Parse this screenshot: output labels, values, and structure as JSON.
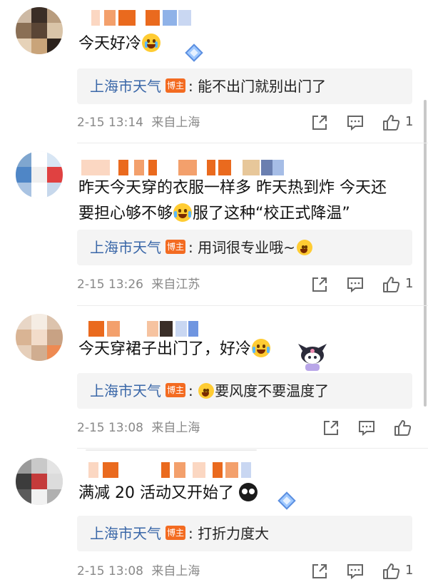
{
  "comments": [
    {
      "text": "今天好冷",
      "reply": {
        "replier": "上海市天气",
        "badge": "博主",
        "text": ": 能不出门就别出门了"
      },
      "time": "2-15 13:14",
      "location": "来自上海",
      "likes": "1"
    },
    {
      "text_line1": "昨天今天穿的衣服一样多 昨天热到炸 今天还",
      "text_line2a": "要担心够不够",
      "text_line2b": "服了这种“校正式降温”",
      "reply": {
        "replier": "上海市天气",
        "badge": "博主",
        "text": ": 用词很专业哦~"
      },
      "time": "2-15 13:26",
      "location": "来自江苏",
      "likes": "1"
    },
    {
      "text": "今天穿裙子出门了，好冷",
      "reply": {
        "replier": "上海市天气",
        "badge": "博主",
        "text": "要风度不要温度了"
      },
      "time": "2-15 13:08",
      "location": "来自上海",
      "likes": ""
    },
    {
      "text": "满减 20 活动又开始了",
      "reply": {
        "replier": "上海市天气",
        "badge": "博主",
        "text": ": 打折力度大"
      },
      "time": "2-15 13:08",
      "location": "来自上海",
      "likes": "1"
    }
  ],
  "icons": {
    "share": "share-icon",
    "comment": "comment-icon",
    "like": "thumbs-up-icon",
    "badge_level": "level-badge-icon"
  },
  "colors": {
    "link_blue": "#3a67a8",
    "badge_orange": "#f36b21",
    "reply_bg": "#f4f4f4",
    "meta_gray": "#888888"
  }
}
